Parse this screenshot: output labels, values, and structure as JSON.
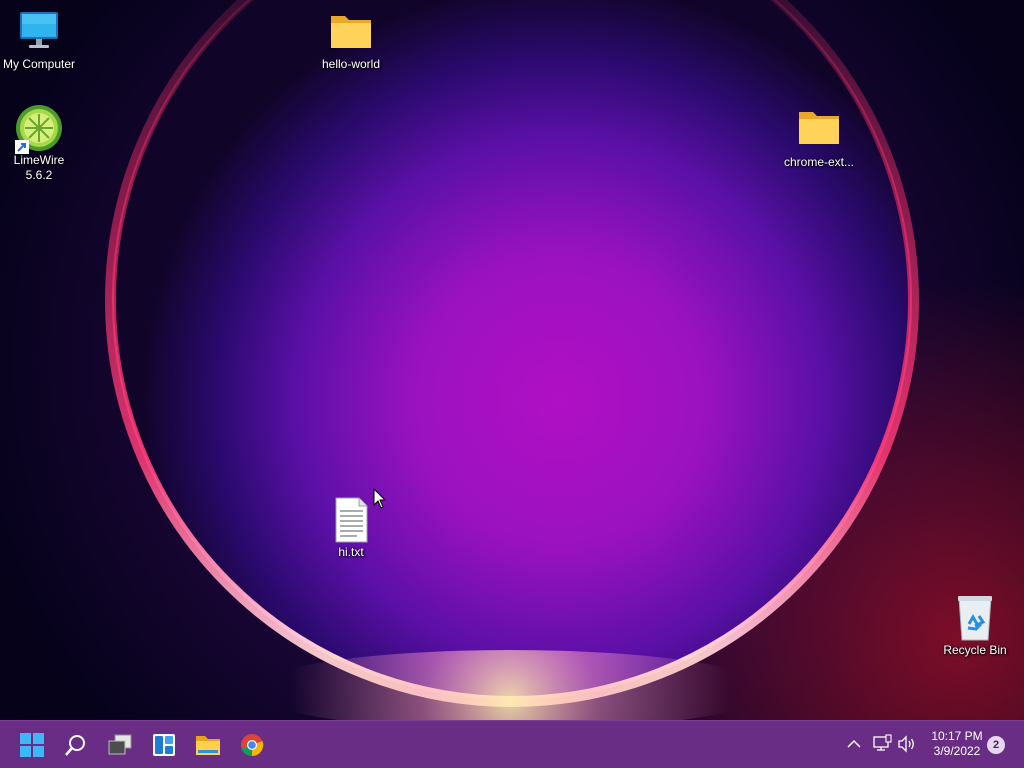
{
  "desktop": {
    "icons": {
      "my_computer": {
        "label": "My Computer",
        "icon": "monitor-icon"
      },
      "limewire": {
        "label": "LimeWire\n5.6.2",
        "icon": "limewire-icon",
        "shortcut": true
      },
      "hello_world": {
        "label": "hello-world",
        "icon": "folder-icon"
      },
      "chrome_ext": {
        "label": "chrome-ext...",
        "icon": "folder-icon"
      },
      "hi_txt": {
        "label": "hi.txt",
        "icon": "text-file-icon"
      },
      "recycle_bin": {
        "label": "Recycle Bin",
        "icon": "recycle-bin-icon"
      }
    }
  },
  "taskbar": {
    "pinned": [
      {
        "name": "Start",
        "icon": "windows-start-icon"
      },
      {
        "name": "Search",
        "icon": "search-icon"
      },
      {
        "name": "Task View",
        "icon": "task-view-icon"
      },
      {
        "name": "Widgets",
        "icon": "widgets-icon"
      },
      {
        "name": "File Explorer",
        "icon": "file-explorer-icon"
      },
      {
        "name": "Google Chrome",
        "icon": "chrome-icon"
      }
    ],
    "tray": {
      "icons": [
        "chevron-up-icon",
        "network-icon",
        "volume-icon"
      ],
      "time": "10:17 PM",
      "date": "3/9/2022",
      "notification_count": "2"
    }
  },
  "colors": {
    "taskbar": "#6a2d86",
    "wallpaper_dark": "#06031a",
    "wallpaper_glow": "#a20fb7",
    "ring": "#ff3d6b"
  }
}
